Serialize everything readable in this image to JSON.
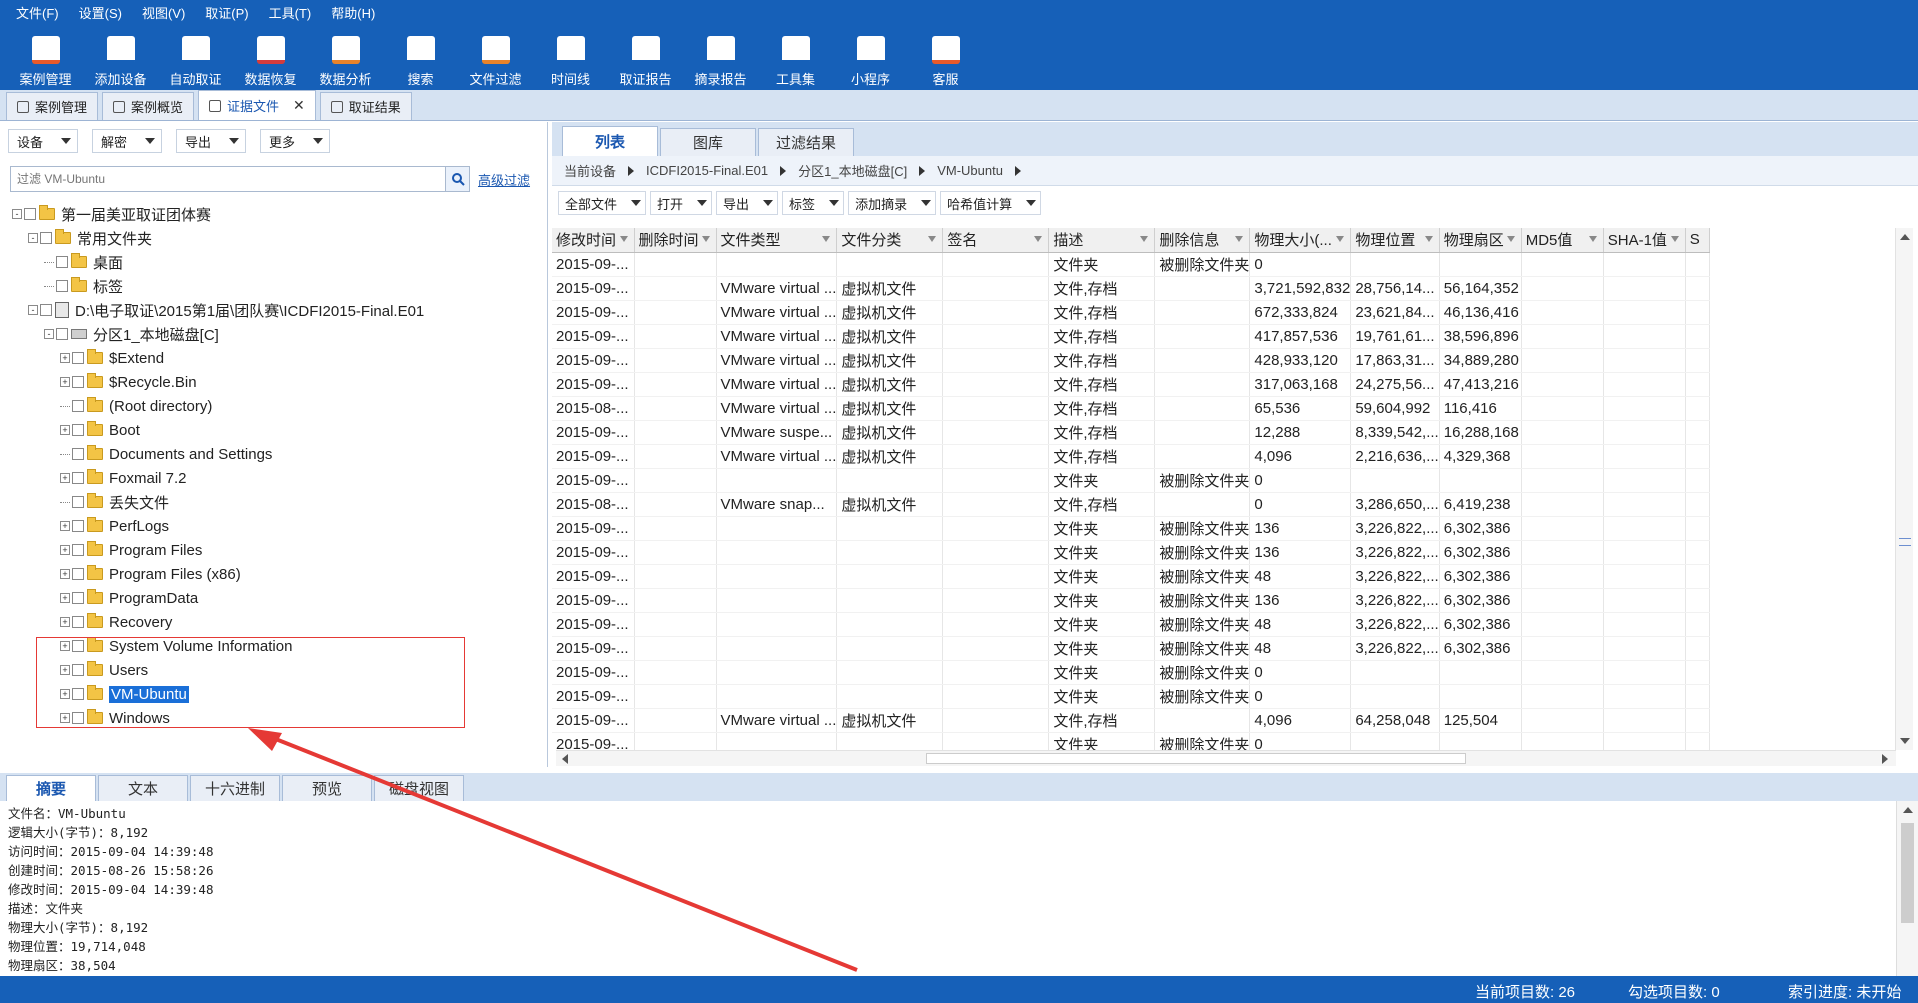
{
  "menu": [
    "文件(F)",
    "设置(S)",
    "视图(V)",
    "取证(P)",
    "工具(T)",
    "帮助(H)"
  ],
  "ribbon": [
    {
      "label": "案例管理",
      "icon": "case-icon"
    },
    {
      "label": "添加设备",
      "icon": "add-device-icon"
    },
    {
      "label": "自动取证",
      "icon": "auto-icon"
    },
    {
      "label": "数据恢复",
      "icon": "recover-icon"
    },
    {
      "label": "数据分析",
      "icon": "analysis-icon"
    },
    {
      "label": "搜索",
      "icon": "search-icon"
    },
    {
      "label": "文件过滤",
      "icon": "filter-icon"
    },
    {
      "label": "时间线",
      "icon": "timeline-icon"
    },
    {
      "label": "取证报告",
      "icon": "report-icon"
    },
    {
      "label": "摘录报告",
      "icon": "excerpt-icon"
    },
    {
      "label": "工具集",
      "icon": "toolset-icon"
    },
    {
      "label": "小程序",
      "icon": "miniapp-icon"
    },
    {
      "label": "客服",
      "icon": "support-icon"
    }
  ],
  "tabs": [
    "案例管理",
    "案例概览",
    "证据文件",
    "取证结果"
  ],
  "left": {
    "toolbar": [
      "设备",
      "解密",
      "导出",
      "更多"
    ],
    "filter_placeholder": "过滤 VM-Ubuntu",
    "advanced_filter": "高级过滤",
    "tree": [
      {
        "label": "第一届美亚取证团体赛",
        "level": 0,
        "icon": "folder",
        "expand": "-"
      },
      {
        "label": "常用文件夹",
        "level": 1,
        "icon": "folder",
        "expand": "-"
      },
      {
        "label": "桌面",
        "level": 2,
        "icon": "folder",
        "expand": ""
      },
      {
        "label": "标签",
        "level": 2,
        "icon": "folder",
        "expand": ""
      },
      {
        "label": "D:\\电子取证\\2015第1届\\团队赛\\ICDFI2015-Final.E01",
        "level": 1,
        "icon": "disk",
        "expand": "-"
      },
      {
        "label": "分区1_本地磁盘[C]",
        "level": 2,
        "icon": "drive",
        "expand": "-"
      },
      {
        "label": "$Extend",
        "level": 3,
        "icon": "folder",
        "expand": "+"
      },
      {
        "label": "$Recycle.Bin",
        "level": 3,
        "icon": "folder",
        "expand": "+"
      },
      {
        "label": "(Root directory)",
        "level": 3,
        "icon": "folder",
        "expand": ""
      },
      {
        "label": "Boot",
        "level": 3,
        "icon": "folder",
        "expand": "+"
      },
      {
        "label": "Documents and Settings",
        "level": 3,
        "icon": "folder",
        "expand": ""
      },
      {
        "label": "Foxmail 7.2",
        "level": 3,
        "icon": "folder",
        "expand": "+"
      },
      {
        "label": "丢失文件",
        "level": 3,
        "icon": "folder",
        "expand": ""
      },
      {
        "label": "PerfLogs",
        "level": 3,
        "icon": "folder",
        "expand": "+"
      },
      {
        "label": "Program Files",
        "level": 3,
        "icon": "folder",
        "expand": "+"
      },
      {
        "label": "Program Files (x86)",
        "level": 3,
        "icon": "folder",
        "expand": "+"
      },
      {
        "label": "ProgramData",
        "level": 3,
        "icon": "folder",
        "expand": "+"
      },
      {
        "label": "Recovery",
        "level": 3,
        "icon": "folder",
        "expand": "+"
      },
      {
        "label": "System Volume Information",
        "level": 3,
        "icon": "folder",
        "expand": "+"
      },
      {
        "label": "Users",
        "level": 3,
        "icon": "folder",
        "expand": "+"
      },
      {
        "label": "VM-Ubuntu",
        "level": 3,
        "icon": "folder",
        "expand": "+",
        "selected": true
      },
      {
        "label": "Windows",
        "level": 3,
        "icon": "folder",
        "expand": "+"
      }
    ]
  },
  "right": {
    "tabs": [
      "列表",
      "图库",
      "过滤结果"
    ],
    "breadcrumb": [
      "当前设备",
      "ICDFI2015-Final.E01",
      "分区1_本地磁盘[C]",
      "VM-Ubuntu"
    ],
    "toolbar": [
      "全部文件",
      "打开",
      "导出",
      "标签",
      "添加摘录",
      "哈希值计算"
    ],
    "columns": [
      "修改时间",
      "删除时间",
      "文件类型",
      "文件分类",
      "签名",
      "描述",
      "删除信息",
      "物理大小(...",
      "物理位置",
      "物理扇区",
      "MD5值",
      "SHA-1值",
      "S"
    ],
    "rows": [
      [
        "2015-09-...",
        "",
        "",
        "",
        "",
        "文件夹",
        "被删除文件夹",
        "0",
        "",
        "",
        "",
        ""
      ],
      [
        "2015-09-...",
        "",
        "VMware virtual ...",
        "虚拟机文件",
        "",
        "文件,存档",
        "",
        "3,721,592,832",
        "28,756,14...",
        "56,164,352",
        "",
        ""
      ],
      [
        "2015-09-...",
        "",
        "VMware virtual ...",
        "虚拟机文件",
        "",
        "文件,存档",
        "",
        "672,333,824",
        "23,621,84...",
        "46,136,416",
        "",
        ""
      ],
      [
        "2015-09-...",
        "",
        "VMware virtual ...",
        "虚拟机文件",
        "",
        "文件,存档",
        "",
        "417,857,536",
        "19,761,61...",
        "38,596,896",
        "",
        ""
      ],
      [
        "2015-09-...",
        "",
        "VMware virtual ...",
        "虚拟机文件",
        "",
        "文件,存档",
        "",
        "428,933,120",
        "17,863,31...",
        "34,889,280",
        "",
        ""
      ],
      [
        "2015-09-...",
        "",
        "VMware virtual ...",
        "虚拟机文件",
        "",
        "文件,存档",
        "",
        "317,063,168",
        "24,275,56...",
        "47,413,216",
        "",
        ""
      ],
      [
        "2015-08-...",
        "",
        "VMware virtual ...",
        "虚拟机文件",
        "",
        "文件,存档",
        "",
        "65,536",
        "59,604,992",
        "116,416",
        "",
        ""
      ],
      [
        "2015-09-...",
        "",
        "VMware suspe...",
        "虚拟机文件",
        "",
        "文件,存档",
        "",
        "12,288",
        "8,339,542,...",
        "16,288,168",
        "",
        ""
      ],
      [
        "2015-09-...",
        "",
        "VMware virtual ...",
        "虚拟机文件",
        "",
        "文件,存档",
        "",
        "4,096",
        "2,216,636,...",
        "4,329,368",
        "",
        ""
      ],
      [
        "2015-09-...",
        "",
        "",
        "",
        "",
        "文件夹",
        "被删除文件夹",
        "0",
        "",
        "",
        "",
        ""
      ],
      [
        "2015-08-...",
        "",
        "VMware snap...",
        "虚拟机文件",
        "",
        "文件,存档",
        "",
        "0",
        "3,286,650,...",
        "6,419,238",
        "",
        ""
      ],
      [
        "2015-09-...",
        "",
        "",
        "",
        "",
        "文件夹",
        "被删除文件夹",
        "136",
        "3,226,822,...",
        "6,302,386",
        "",
        ""
      ],
      [
        "2015-09-...",
        "",
        "",
        "",
        "",
        "文件夹",
        "被删除文件夹",
        "136",
        "3,226,822,...",
        "6,302,386",
        "",
        ""
      ],
      [
        "2015-09-...",
        "",
        "",
        "",
        "",
        "文件夹",
        "被删除文件夹",
        "48",
        "3,226,822,...",
        "6,302,386",
        "",
        ""
      ],
      [
        "2015-09-...",
        "",
        "",
        "",
        "",
        "文件夹",
        "被删除文件夹",
        "136",
        "3,226,822,...",
        "6,302,386",
        "",
        ""
      ],
      [
        "2015-09-...",
        "",
        "",
        "",
        "",
        "文件夹",
        "被删除文件夹",
        "48",
        "3,226,822,...",
        "6,302,386",
        "",
        ""
      ],
      [
        "2015-09-...",
        "",
        "",
        "",
        "",
        "文件夹",
        "被删除文件夹",
        "48",
        "3,226,822,...",
        "6,302,386",
        "",
        ""
      ],
      [
        "2015-09-...",
        "",
        "",
        "",
        "",
        "文件夹",
        "被删除文件夹",
        "0",
        "",
        "",
        "",
        ""
      ],
      [
        "2015-09-...",
        "",
        "",
        "",
        "",
        "文件夹",
        "被删除文件夹",
        "0",
        "",
        "",
        "",
        ""
      ],
      [
        "2015-09-...",
        "",
        "VMware virtual ...",
        "虚拟机文件",
        "",
        "文件,存档",
        "",
        "4,096",
        "64,258,048",
        "125,504",
        "",
        ""
      ],
      [
        "2015-09-...",
        "",
        "",
        "",
        "",
        "文件夹",
        "被删除文件夹",
        "0",
        "",
        "",
        "",
        ""
      ]
    ]
  },
  "bottom": {
    "tabs": [
      "摘要",
      "文本",
      "十六进制",
      "预览",
      "磁盘视图"
    ],
    "summary": [
      "文件名：VM-Ubuntu",
      "逻辑大小(字节)：8,192",
      "访问时间：2015-09-04 14:39:48",
      "创建时间：2015-08-26 15:58:26",
      "修改时间：2015-09-04 14:39:48",
      "描述：文件夹",
      "物理大小(字节)：8,192",
      "物理位置：19,714,048",
      "物理扇区：38,504"
    ]
  },
  "status": {
    "current": "当前项目数: 26",
    "checked": "勾选项目数: 0",
    "index": "索引进度: 未开始"
  },
  "colors": {
    "primary": "#1660b8",
    "selection": "#1a6fd8",
    "annotation": "#e53935"
  }
}
